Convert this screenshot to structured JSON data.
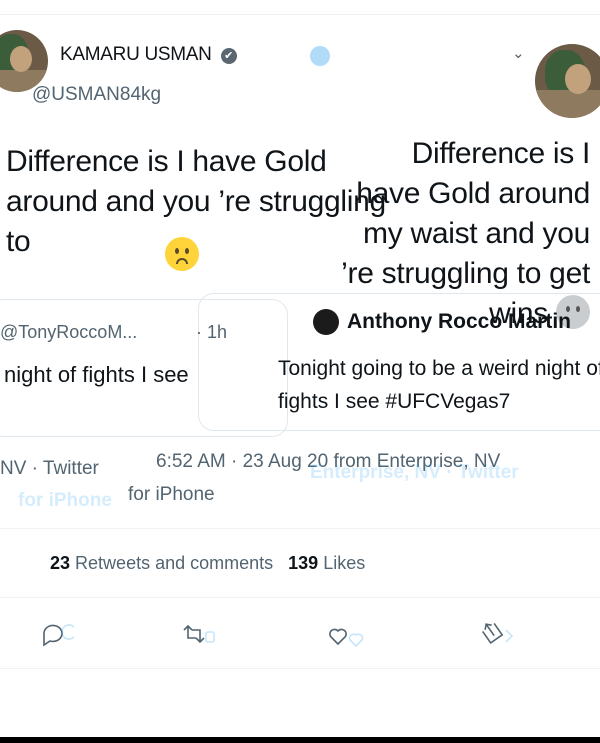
{
  "tweet_author": {
    "display_name": "KAMARU USMAN",
    "verified_glyph": "✔",
    "handle": "@USMAN84kg"
  },
  "tweet": {
    "text_left": "Difference is I have Gold around and you ’re struggling to",
    "text_right": "Difference is I have Gold around my waist and you ’re struggling to get wins"
  },
  "quoted": {
    "author_handle": "@TonyRoccoM...",
    "time": "· 1h",
    "author_name": "Anthony Rocco Martin",
    "text_left": "night of fights I see",
    "text_right": "Tonight going to be a weird night of fights I see #UFCVegas7"
  },
  "meta": {
    "right_line": "6:52 AM · 23 Aug 20 from Enterprise, NV",
    "left_line": "NV · Twitter",
    "left_line2": "for iPhone",
    "ghost_line": "Enterprise, NV · Twitter",
    "ghost_line2": "for iPhone"
  },
  "stats": {
    "retweets": "23",
    "retweets_label": "Retweets and comments",
    "likes": "139",
    "likes_label": "Likes"
  },
  "icons": {
    "reply": "reply-icon",
    "retweet": "retweet-icon",
    "like": "heart-icon",
    "share": "share-icon",
    "caret": "chevron-down-icon"
  },
  "colors": {
    "accent": "#1d9bf0",
    "text": "#0f1419",
    "secondary": "#536471",
    "border": "#eff3f4"
  }
}
